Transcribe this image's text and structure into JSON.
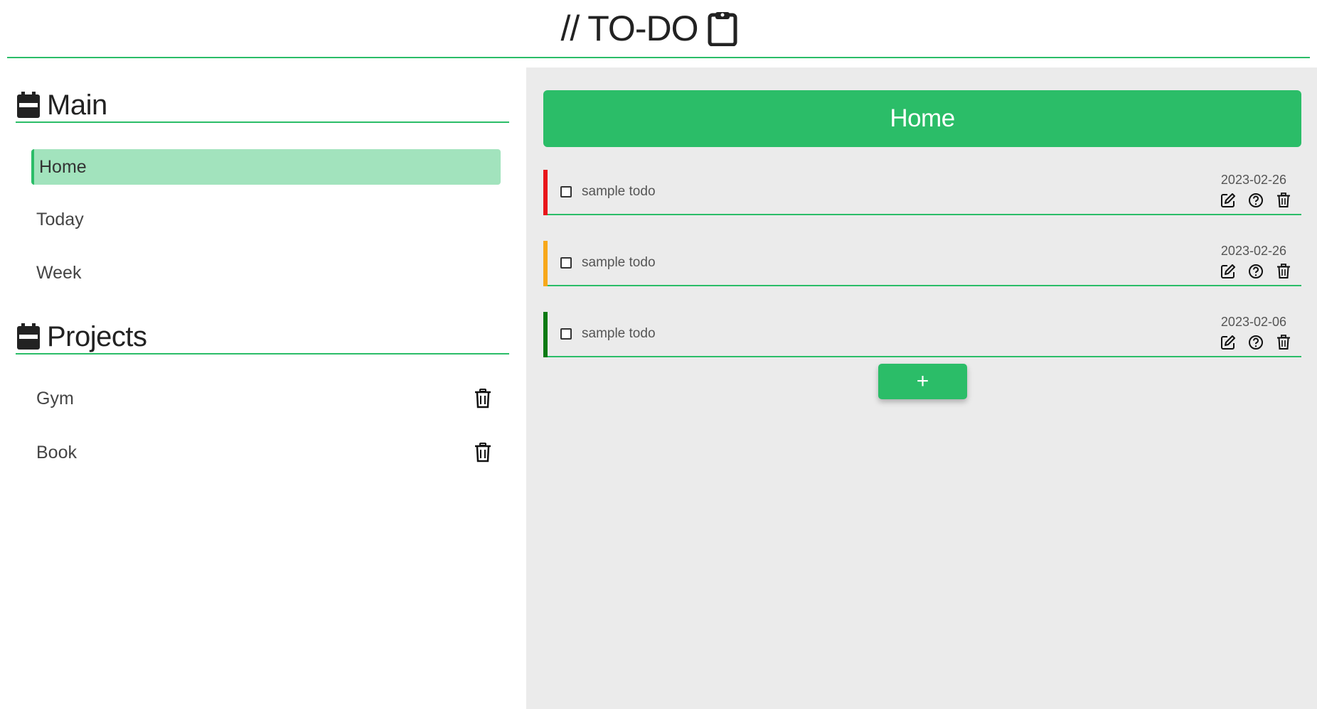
{
  "app": {
    "title": "// TO-DO",
    "accent_color": "#2bbd68",
    "title_icon": "clipboard-icon"
  },
  "sidebar": {
    "main_heading": "Main",
    "main_items": [
      {
        "label": "Home",
        "active": true
      },
      {
        "label": "Today",
        "active": false
      },
      {
        "label": "Week",
        "active": false
      }
    ],
    "projects_heading": "Projects",
    "projects": [
      {
        "label": "Gym"
      },
      {
        "label": "Book"
      }
    ]
  },
  "main": {
    "title": "Home",
    "todos": [
      {
        "title": "sample todo",
        "date": "2023-02-26",
        "priority_color": "#e8161b",
        "checked": false
      },
      {
        "title": "sample todo",
        "date": "2023-02-26",
        "priority_color": "#f7a81b",
        "checked": false
      },
      {
        "title": "sample todo",
        "date": "2023-02-06",
        "priority_color": "#0b7a14",
        "checked": false
      }
    ],
    "add_label": "+"
  }
}
